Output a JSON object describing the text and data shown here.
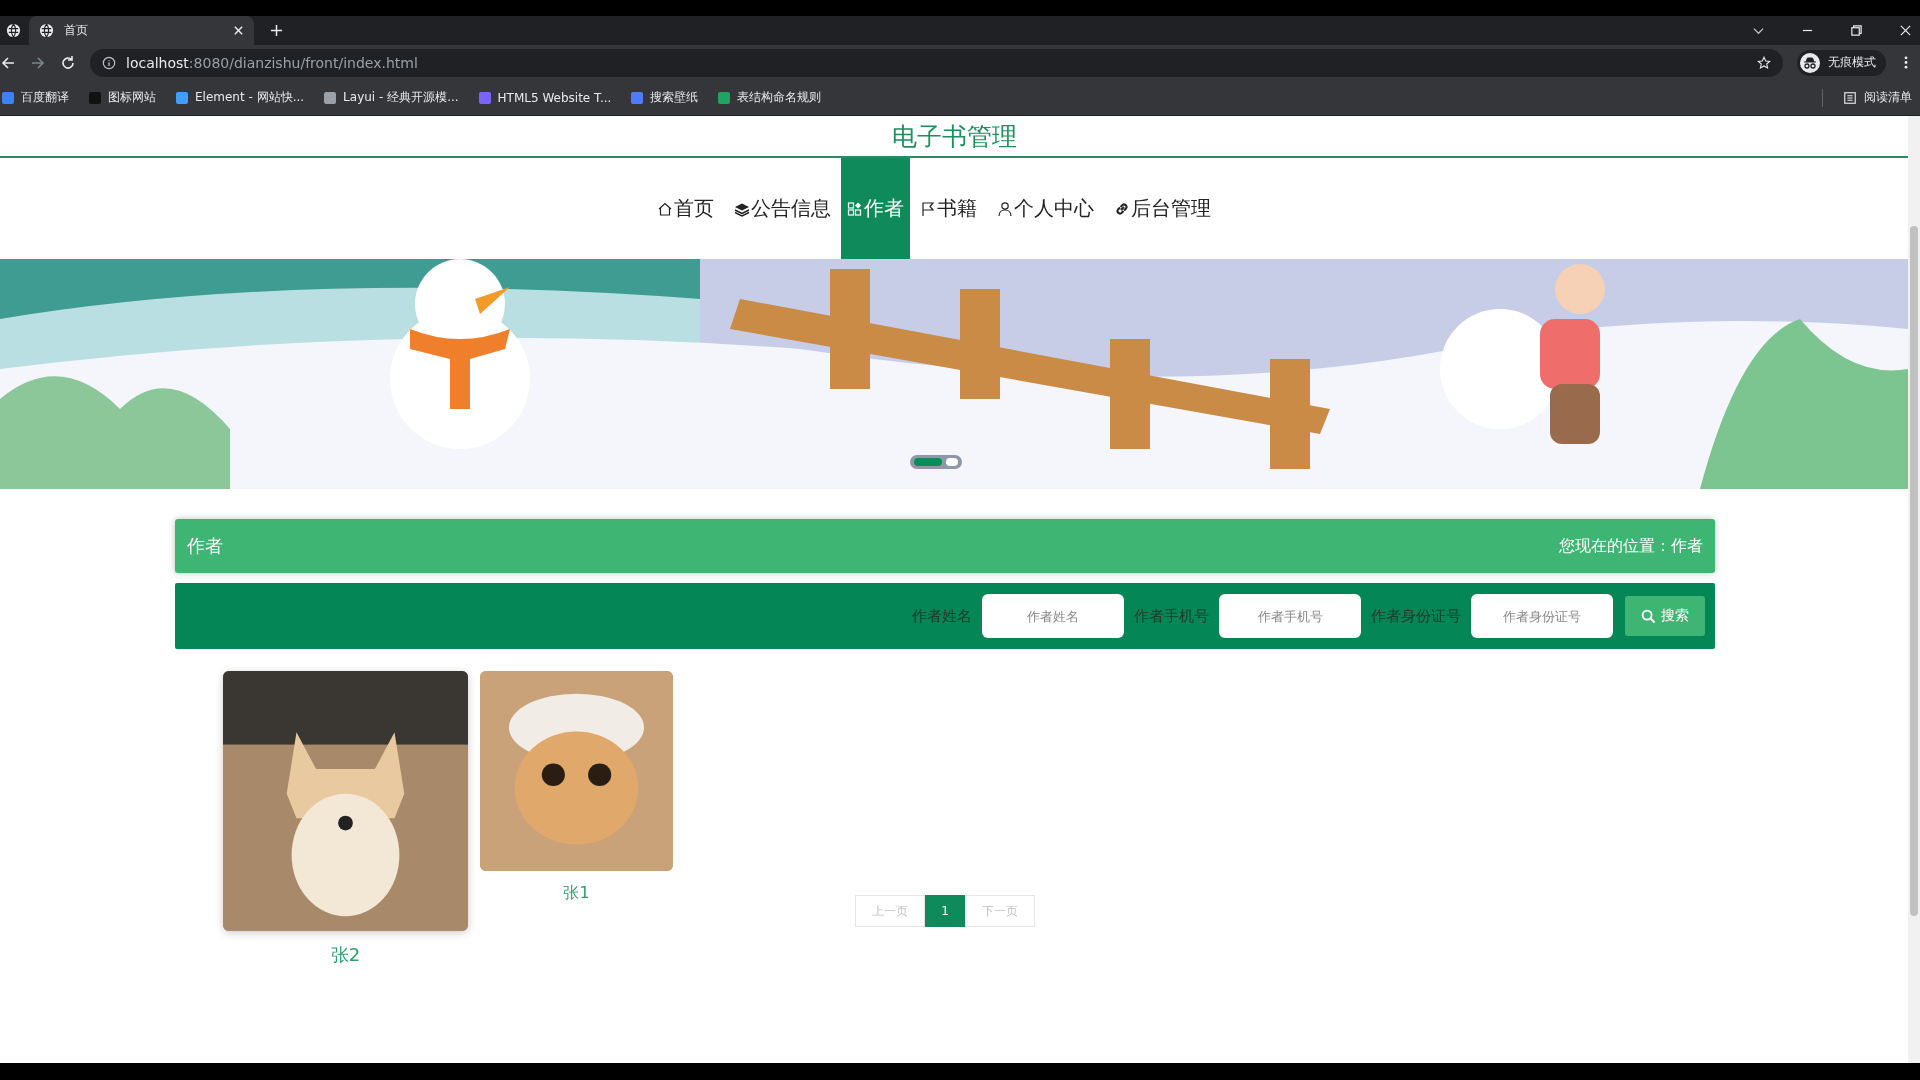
{
  "browser": {
    "tabs": [
      {
        "title": "首页",
        "selected": true
      }
    ],
    "address": {
      "host": "localhost",
      "path": ":8080/dianzishu/front/index.html"
    },
    "profile": "无痕模式",
    "bookmarks": [
      {
        "label": "百度翻译",
        "color": "#3b82f6"
      },
      {
        "label": "图标网站",
        "color": "#111111"
      },
      {
        "label": "Element - 网站快...",
        "color": "#409eff"
      },
      {
        "label": "Layui - 经典开源模...",
        "color": "#9aa0a6"
      },
      {
        "label": "HTML5 Website T...",
        "color": "#7b61ff"
      },
      {
        "label": "搜索壁纸",
        "color": "#4f7cff"
      },
      {
        "label": "表结构命名规则",
        "color": "#1fa463"
      }
    ],
    "reading_list": "阅读清单"
  },
  "site_title": "电子书管理",
  "nav": [
    {
      "label": "首页",
      "kind": "home",
      "selected": false
    },
    {
      "label": "公告信息",
      "kind": "layers",
      "selected": false
    },
    {
      "label": "作者",
      "kind": "grid",
      "selected": true
    },
    {
      "label": "书籍",
      "kind": "flag",
      "selected": false
    },
    {
      "label": "个人中心",
      "kind": "user",
      "selected": false
    },
    {
      "label": "后台管理",
      "kind": "link",
      "selected": false
    }
  ],
  "carousel": {
    "dots": [
      {
        "selected": true
      },
      {
        "selected": false
      }
    ]
  },
  "section": {
    "title": "作者",
    "breadcrumb": "您现在的位置：作者"
  },
  "search": {
    "fields": [
      {
        "label": "作者姓名",
        "placeholder": "作者姓名"
      },
      {
        "label": "作者手机号",
        "placeholder": "作者手机号"
      },
      {
        "label": "作者身份证号",
        "placeholder": "作者身份证号"
      }
    ],
    "button": "搜索"
  },
  "authors": [
    {
      "name": "张2",
      "kind": "dog",
      "hovered": true
    },
    {
      "name": "张1",
      "kind": "cat",
      "hovered": false
    }
  ],
  "pagination": {
    "prev": "上一页",
    "pages": [
      {
        "label": "1",
        "selected": true
      }
    ],
    "next": "下一页"
  }
}
